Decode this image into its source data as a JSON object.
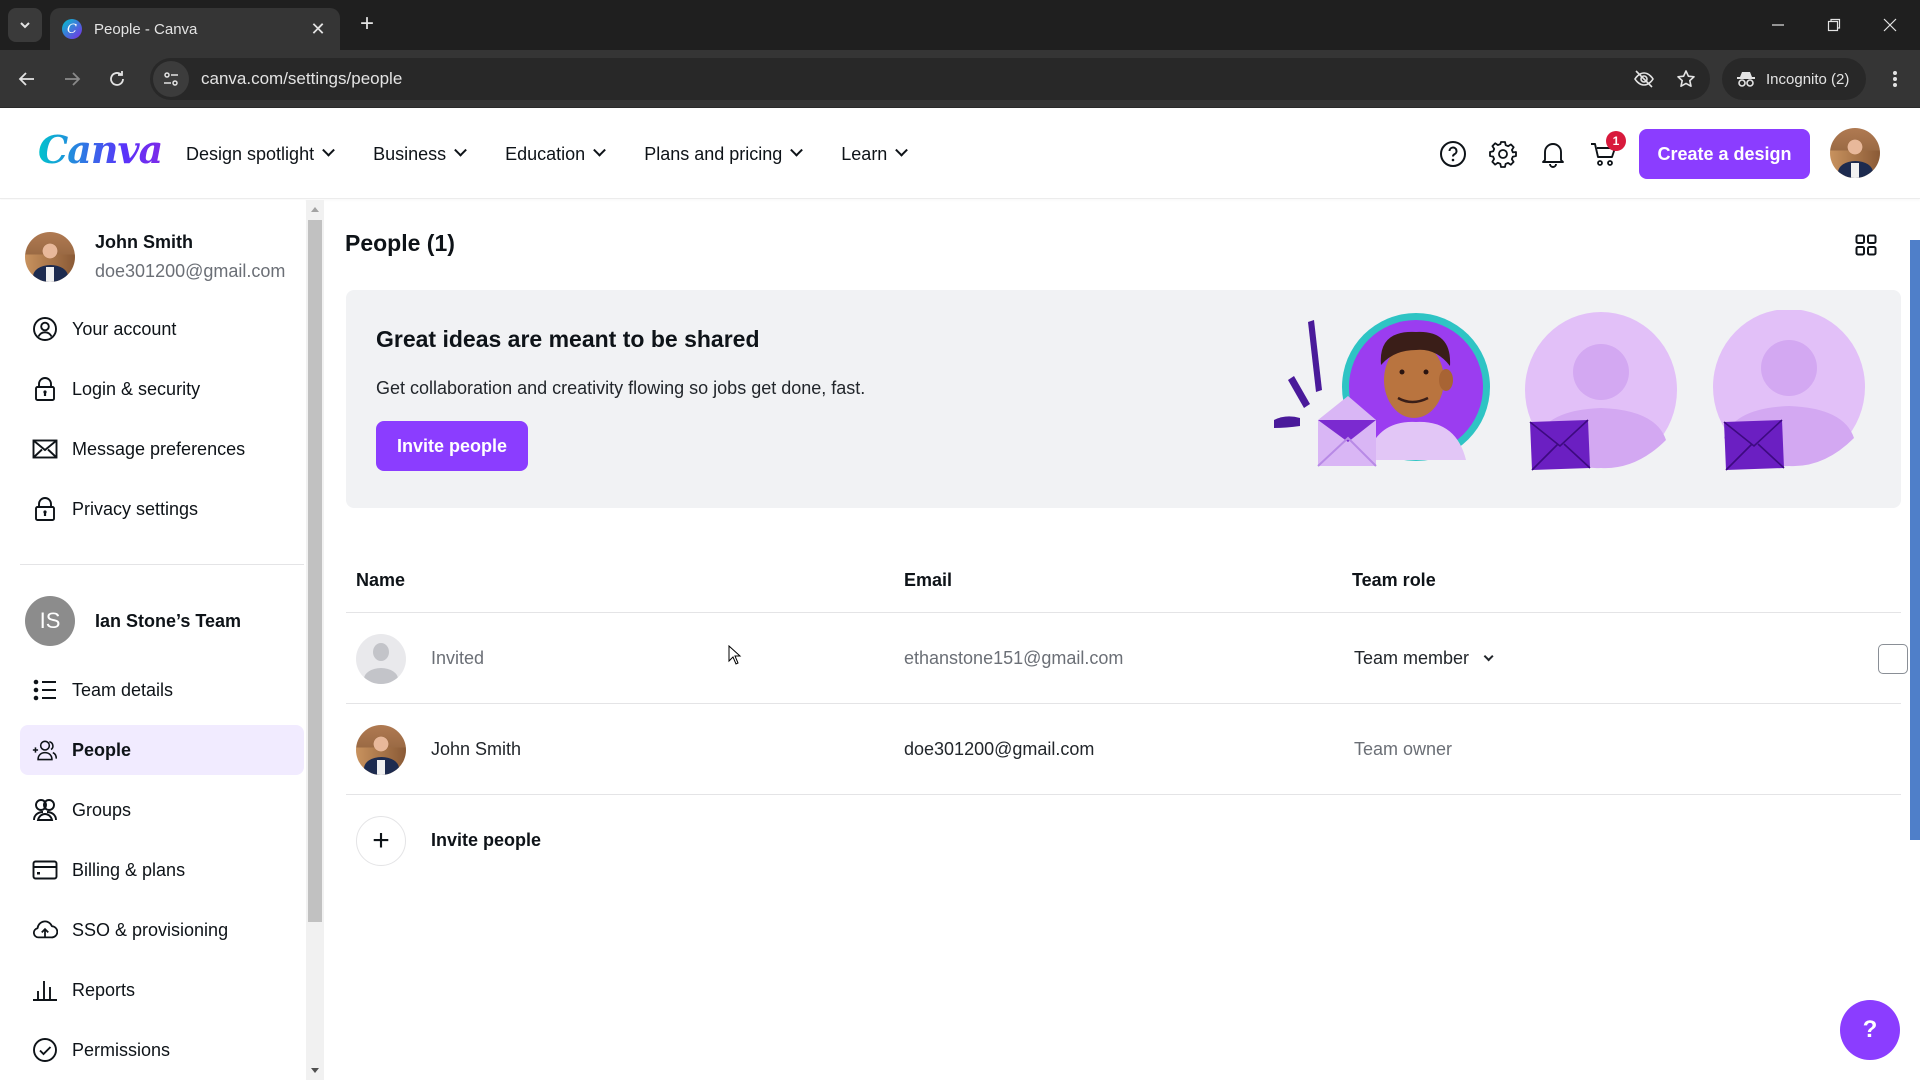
{
  "browser": {
    "tab_title": "People - Canva",
    "url": "canva.com/settings/people",
    "incognito_label": "Incognito (2)",
    "icons": [
      "tab-search-icon",
      "canva-favicon",
      "close-icon",
      "new-tab-icon",
      "minimize-icon",
      "restore-icon",
      "window-close-icon",
      "back-icon",
      "forward-icon",
      "reload-icon",
      "site-info-icon",
      "eye-off-icon",
      "star-icon",
      "incognito-icon",
      "kebab-menu-icon"
    ],
    "glyphs": {
      "tab_search": "⌄",
      "favicon": "C",
      "close": "✕",
      "new_tab": "+",
      "minimize": "—",
      "restore": "❐",
      "window_close": "✕",
      "back": "←",
      "forward": "→",
      "reload": "↻",
      "site_info": "⚙",
      "star": "☆",
      "incognito": "🕶",
      "kebab": "⋮"
    }
  },
  "header": {
    "logo": "Canva",
    "nav": [
      {
        "label": "Design spotlight"
      },
      {
        "label": "Business"
      },
      {
        "label": "Education"
      },
      {
        "label": "Plans and pricing"
      },
      {
        "label": "Learn"
      }
    ],
    "cart_badge": "1",
    "create_button": "Create a design",
    "brand_color": "#8b3dff"
  },
  "sidebar": {
    "user": {
      "name": "John Smith",
      "email": "doe301200@gmail.com"
    },
    "account_items": [
      {
        "label": "Your account",
        "icon": "user-circle-icon"
      },
      {
        "label": "Login & security",
        "icon": "lock-icon"
      },
      {
        "label": "Message preferences",
        "icon": "mail-icon"
      },
      {
        "label": "Privacy settings",
        "icon": "lock-icon"
      }
    ],
    "team": {
      "initials": "IS",
      "name": "Ian Stone’s Team"
    },
    "team_items": [
      {
        "label": "Team details",
        "icon": "list-icon",
        "active": false
      },
      {
        "label": "People",
        "icon": "add-people-icon",
        "active": true
      },
      {
        "label": "Groups",
        "icon": "groups-icon",
        "active": false
      },
      {
        "label": "Billing & plans",
        "icon": "credit-card-icon",
        "active": false
      },
      {
        "label": "SSO & provisioning",
        "icon": "cloud-upload-icon",
        "active": false
      },
      {
        "label": "Reports",
        "icon": "bar-chart-icon",
        "active": false
      },
      {
        "label": "Permissions",
        "icon": "check-circle-icon",
        "active": false
      }
    ]
  },
  "main": {
    "title": "People (1)",
    "banner": {
      "heading": "Great ideas are meant to be shared",
      "description": "Get collaboration and creativity flowing so jobs get done, fast.",
      "button": "Invite people"
    },
    "table": {
      "columns": [
        "Name",
        "Email",
        "Team role"
      ],
      "rows": [
        {
          "name": "Invited",
          "email": "ethanstone151@gmail.com",
          "role": "Team member",
          "role_editable": true,
          "checkbox": false
        },
        {
          "name": "John Smith",
          "email": "doe301200@gmail.com",
          "role": "Team owner",
          "role_editable": false
        }
      ],
      "invite_row_label": "Invite people"
    },
    "help_button": "?"
  }
}
